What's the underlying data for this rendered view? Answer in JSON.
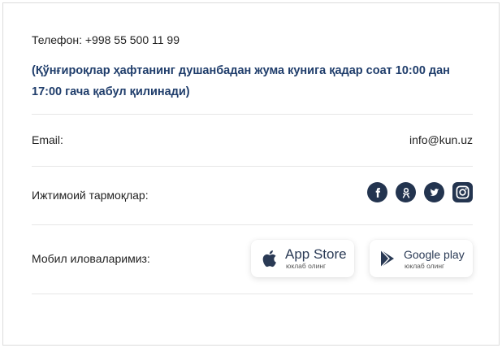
{
  "contact": {
    "phone": "Телефон: +998 55 500 11 99",
    "hours_note": "(Қўнғироқлар ҳафтанинг душанбадан жума кунига қадар соат 10:00 дан 17:00 гача қабул қилинади)"
  },
  "email_row": {
    "label": "Email:",
    "value": "info@kun.uz"
  },
  "social_row": {
    "label": "Ижтимоий тармоқлар:",
    "icons": [
      "facebook-icon",
      "odnoklassniki-icon",
      "twitter-icon",
      "instagram-icon"
    ]
  },
  "apps_row": {
    "label": "Мобил иловаларимиз:",
    "app_store": {
      "name": "App Store",
      "sub": "юклаб олинг"
    },
    "google_play": {
      "name": "Google play",
      "sub": "юклаб олинг"
    }
  },
  "colors": {
    "accent": "#1f3d6b",
    "icon_bg": "#23344f",
    "divider": "#e6e6e6"
  }
}
